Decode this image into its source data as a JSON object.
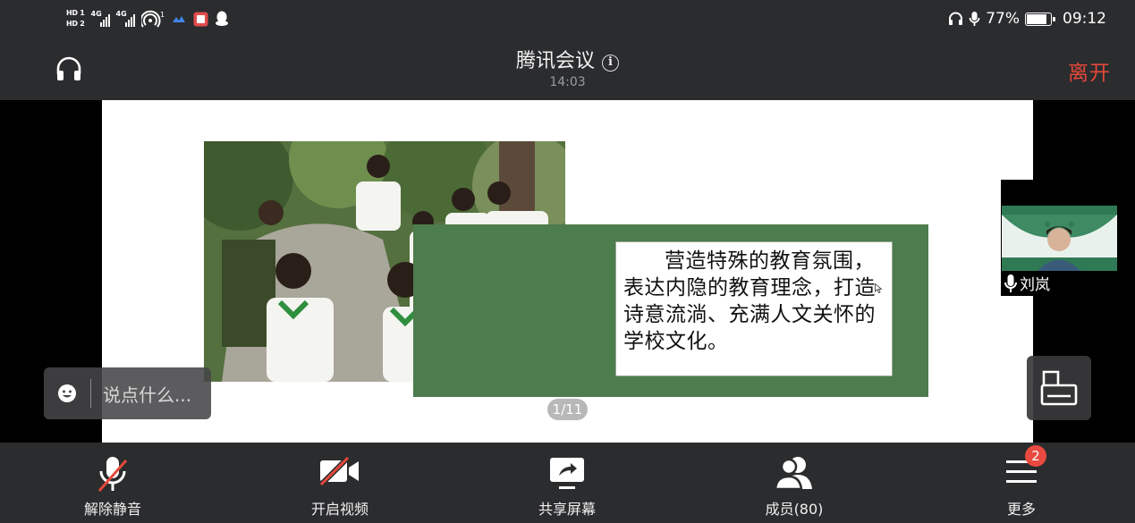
{
  "status_bar": {
    "hd1": "HD 1",
    "hd2": "HD 2",
    "net1": "4G",
    "net2": "4G",
    "wifi_sup": "1",
    "battery_percent": "77%",
    "time": "09:12",
    "battery_level": 0.77,
    "icons": [
      "hd-icon",
      "signal-icon",
      "signal-icon",
      "hotspot-icon",
      "cloud-icon",
      "notes-app-icon",
      "qq-icon",
      "headphone-icon",
      "mic-icon",
      "battery-charging-icon"
    ]
  },
  "header": {
    "title": "腾讯会议",
    "info_symbol": "i",
    "elapsed": "14:03",
    "leave": "离开"
  },
  "slide": {
    "text": "营造特殊的教育氛围，表达内隐的教育理念，打造诗意流淌、充满人文关怀的学校文化。",
    "page": "1/11"
  },
  "participant": {
    "name": "刘岚"
  },
  "chat": {
    "placeholder": "说点什么..."
  },
  "toolbar": {
    "items": [
      {
        "label": "解除静音",
        "icon": "mic-muted-icon"
      },
      {
        "label": "开启视频",
        "icon": "camera-off-icon"
      },
      {
        "label": "共享屏幕",
        "icon": "share-screen-icon"
      },
      {
        "label": "成员(80)",
        "icon": "members-icon"
      },
      {
        "label": "更多",
        "icon": "menu-icon"
      }
    ],
    "more_badge": "2"
  },
  "colors": {
    "bar_bg": "#2b2c2e",
    "leave_red": "#e5493a",
    "slide_green": "#4d7c4e",
    "badge_red": "#e94a3f"
  }
}
